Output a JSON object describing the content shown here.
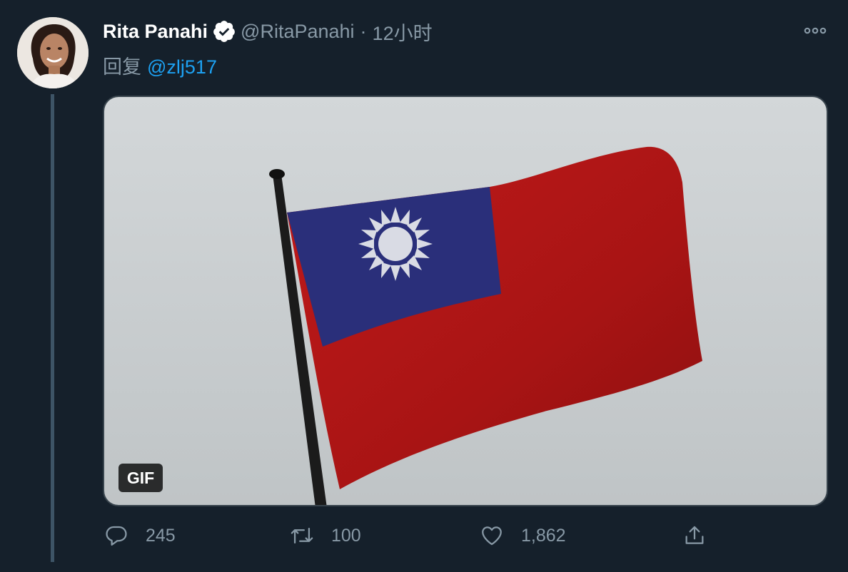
{
  "tweet": {
    "display_name": "Rita Panahi",
    "handle": "@RitaPanahi",
    "separator": "·",
    "time": "12小时",
    "reply_prefix": "回复",
    "reply_to": "@zlj517",
    "media": {
      "badge": "GIF"
    },
    "actions": {
      "reply_count": "245",
      "retweet_count": "100",
      "like_count": "1,862"
    }
  },
  "icons": {
    "verified": "verified-badge-icon",
    "more": "more-options-icon",
    "reply": "reply-icon",
    "retweet": "retweet-icon",
    "like": "heart-icon",
    "share": "share-icon"
  },
  "colors": {
    "background": "#15202b",
    "text_primary": "#ffffff",
    "text_secondary": "#8899a6",
    "accent": "#1da1f2",
    "border": "#38444d"
  }
}
